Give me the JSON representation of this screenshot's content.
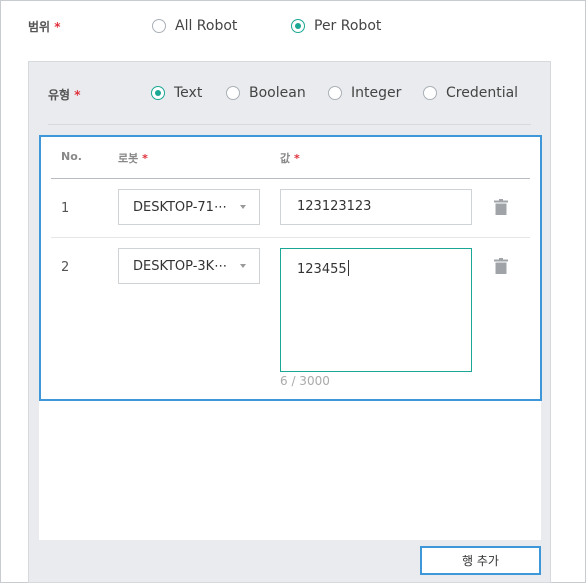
{
  "scope": {
    "label": "범위",
    "required_mark": "*",
    "options": [
      {
        "label": "All Robot",
        "selected": false
      },
      {
        "label": "Per Robot",
        "selected": true
      }
    ]
  },
  "type": {
    "label": "유형",
    "required_mark": "*",
    "options": [
      {
        "label": "Text",
        "selected": true
      },
      {
        "label": "Boolean",
        "selected": false
      },
      {
        "label": "Integer",
        "selected": false
      },
      {
        "label": "Credential",
        "selected": false
      }
    ]
  },
  "table": {
    "headers": {
      "no": "No.",
      "robot": "로봇",
      "value": "값",
      "required_mark": "*"
    },
    "rows": [
      {
        "no": "1",
        "robot": "DESKTOP-71⋯",
        "value": "123123123"
      },
      {
        "no": "2",
        "robot": "DESKTOP-3K⋯",
        "value": "123455",
        "char_count": "6 / 3000"
      }
    ]
  },
  "add_row_label": "행 추가",
  "colors": {
    "accent": "#1aa894",
    "focus": "#3d97d8",
    "required": "#e0303a"
  }
}
